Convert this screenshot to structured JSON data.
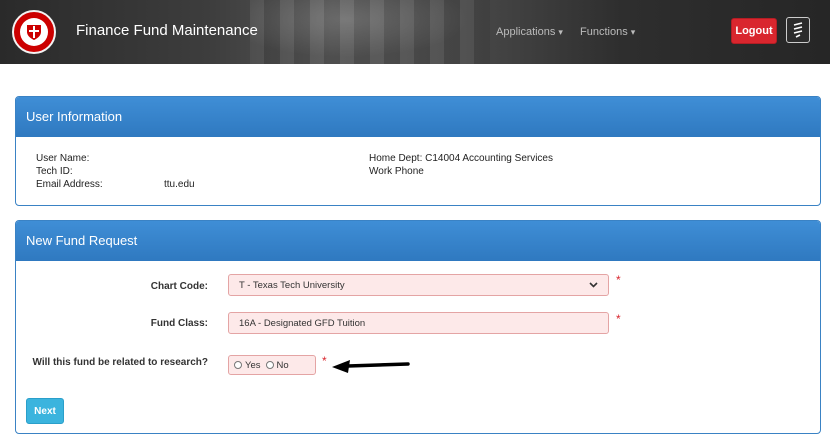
{
  "header": {
    "app_title": "Finance Fund Maintenance",
    "nav": [
      {
        "label": "Applications"
      },
      {
        "label": "Functions"
      }
    ],
    "logout_label": "Logout",
    "colors": {
      "logout": "#d9262e",
      "brand": "#cc0000"
    }
  },
  "user_info": {
    "title": "User Information",
    "user_name_label": "User Name:",
    "tech_id_label": "Tech ID:",
    "email_label": "Email Address:",
    "email_value": "ttu.edu",
    "home_dept": "Home Dept: C14004 Accounting Services",
    "work_phone_label": "Work Phone"
  },
  "fund_request": {
    "title": "New Fund Request",
    "chart_code_label": "Chart Code:",
    "chart_code_value": "T - Texas Tech University",
    "fund_class_label": "Fund Class:",
    "fund_class_value": "16A - Designated GFD Tuition",
    "research_label": "Will this fund be related to research?",
    "research_options": [
      "Yes",
      "No"
    ],
    "required_marker": "*",
    "next_label": "Next",
    "colors": {
      "panel_header": "#3a87cc",
      "field_bg": "#fde9e9",
      "next": "#3bb4de"
    }
  }
}
